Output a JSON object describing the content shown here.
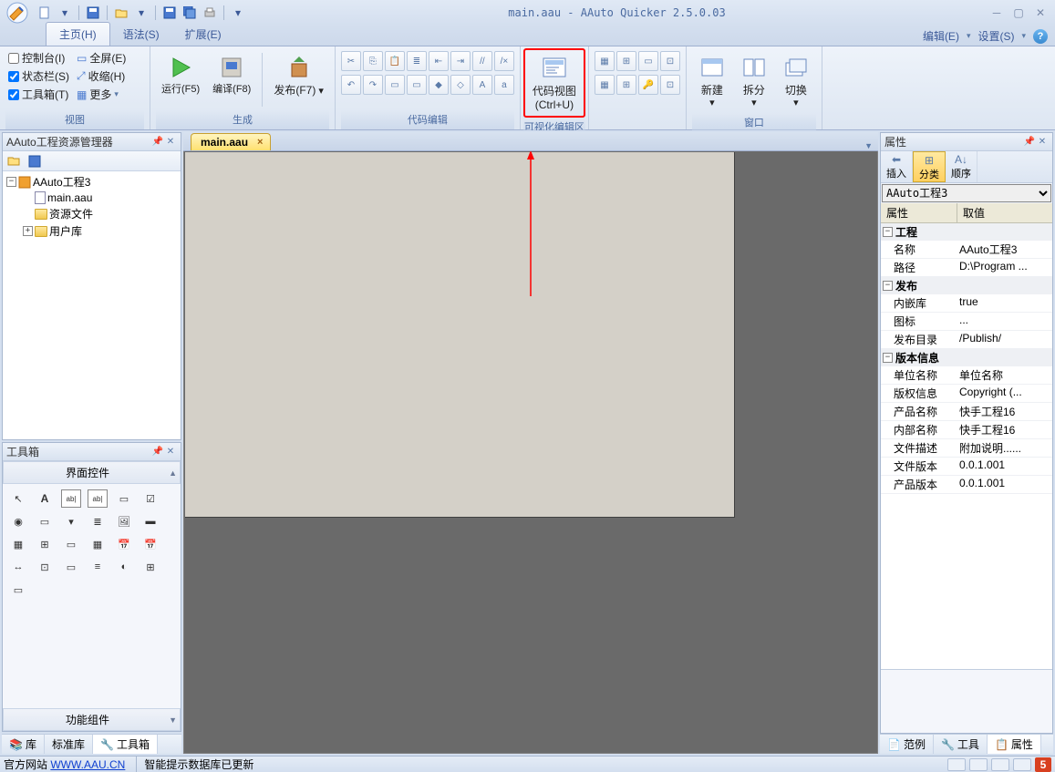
{
  "title": "main.aau - AAuto Quicker 2.5.0.03",
  "menu_tabs": {
    "home": "主页(H)",
    "syntax": "语法(S)",
    "extend": "扩展(E)"
  },
  "menu_right": {
    "edit": "编辑(E)",
    "settings": "设置(S)"
  },
  "ribbon": {
    "view": {
      "label": "视图",
      "console": "控制台(I)",
      "fullscreen": "全屏(E)",
      "statusbar": "状态栏(S)",
      "collapse": "收缩(H)",
      "toolbox": "工具箱(T)",
      "more": "更多"
    },
    "build": {
      "label": "生成",
      "run": "运行(F5)",
      "compile": "编译(F8)",
      "publish": "发布(F7)"
    },
    "codeedit": {
      "label": "代码编辑"
    },
    "codeview": {
      "label": "代码视图",
      "shortcut": "(Ctrl+U)"
    },
    "visualedit": {
      "label": "可视化编辑区"
    },
    "window": {
      "label": "窗口",
      "new": "新建",
      "split": "拆分",
      "switch": "切换"
    }
  },
  "project_panel": {
    "title": "AAuto工程资源管理器",
    "root": "AAuto工程3",
    "items": [
      "main.aau",
      "资源文件",
      "用户库"
    ]
  },
  "toolbox_panel": {
    "title": "工具箱",
    "section1": "界面控件",
    "section2": "功能组件"
  },
  "left_bottom_tabs": {
    "lib": "库",
    "stdlib": "标准库",
    "toolbox": "工具箱"
  },
  "doc_tab": "main.aau",
  "props_panel": {
    "title": "属性",
    "toolbar": {
      "insert": "插入",
      "category": "分类",
      "sort": "顺序"
    },
    "combo": "AAuto工程3",
    "header": {
      "prop": "属性",
      "value": "取值"
    },
    "groups": [
      {
        "name": "工程",
        "rows": [
          {
            "k": "名称",
            "v": "AAuto工程3"
          },
          {
            "k": "路径",
            "v": "D:\\Program ..."
          }
        ]
      },
      {
        "name": "发布",
        "rows": [
          {
            "k": "内嵌库",
            "v": "true"
          },
          {
            "k": "图标",
            "v": "..."
          },
          {
            "k": "发布目录",
            "v": "/Publish/"
          }
        ]
      },
      {
        "name": "版本信息",
        "rows": [
          {
            "k": "单位名称",
            "v": "单位名称"
          },
          {
            "k": "版权信息",
            "v": "Copyright (..."
          },
          {
            "k": "产品名称",
            "v": "快手工程16"
          },
          {
            "k": "内部名称",
            "v": "快手工程16"
          },
          {
            "k": "文件描述",
            "v": "附加说明......"
          },
          {
            "k": "文件版本",
            "v": "0.0.1.001"
          },
          {
            "k": "产品版本",
            "v": "0.0.1.001"
          }
        ]
      }
    ]
  },
  "right_bottom_tabs": {
    "example": "范例",
    "tool": "工具",
    "prop": "属性"
  },
  "status": {
    "site_label": "官方网站",
    "site_url": "WWW.AAU.CN",
    "msg": "智能提示数据库已更新"
  }
}
